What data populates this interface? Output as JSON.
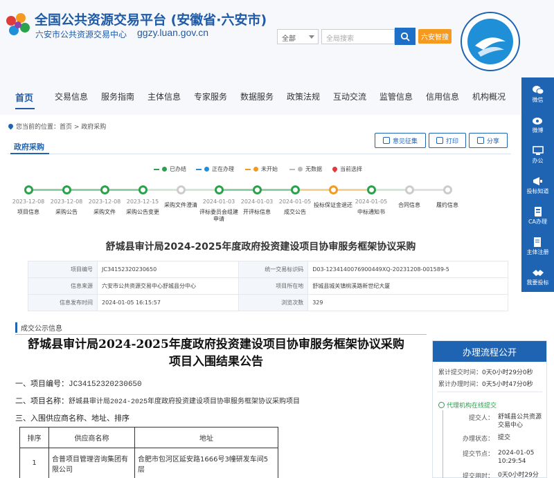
{
  "header": {
    "title": "全国公共资源交易平台 (安徽省·六安市)",
    "subtitle": "六安市公共资源交易中心",
    "domain": "ggzy.luan.gov.cn",
    "search_select": "全部",
    "search_placeholder": "全局搜索",
    "tag": "六安智搜"
  },
  "nav": [
    "首页",
    "交易信息",
    "服务指南",
    "主体信息",
    "专家服务",
    "数据服务",
    "政策法规",
    "互动交流",
    "监管信息",
    "信用信息",
    "机构概况"
  ],
  "side": [
    "微信",
    "微博",
    "办公",
    "投标知道",
    "CA办理",
    "主体注册",
    "我要投标"
  ],
  "crumb": "您当前的位置：首页 > 政府采购",
  "section_tab": "政府采购",
  "actions": [
    "意见征集",
    "打印",
    "分享"
  ],
  "legend": [
    {
      "label": "已办结",
      "color": "#2aa14a"
    },
    {
      "label": "正在办理",
      "color": "#1f8fd8"
    },
    {
      "label": "未开始",
      "color": "#f39a1f"
    },
    {
      "label": "无数据",
      "color": "#bbbbbb"
    },
    {
      "label": "当前选择",
      "color": "#e03b3b"
    }
  ],
  "timeline": [
    {
      "date": "2023-12-08",
      "name": "项目信息",
      "state": "done"
    },
    {
      "date": "2023-12-08",
      "name": "采购公告",
      "state": "done"
    },
    {
      "date": "2023-12-08",
      "name": "采购文件",
      "state": "done"
    },
    {
      "date": "2023-12-15",
      "name": "采购公告变更",
      "state": "done"
    },
    {
      "date": "",
      "name": "采购文件澄清",
      "state": "none"
    },
    {
      "date": "2024-01-03",
      "name": "评标委员会组建申请",
      "state": "done"
    },
    {
      "date": "2024-01-03",
      "name": "开评标信息",
      "state": "done"
    },
    {
      "date": "2024-01-05",
      "name": "成交公告",
      "state": "done"
    },
    {
      "date": "",
      "name": "投标保证金退还",
      "state": "pending"
    },
    {
      "date": "2024-01-05",
      "name": "中标通知书",
      "state": "done"
    },
    {
      "date": "",
      "name": "合同信息",
      "state": "none"
    },
    {
      "date": "",
      "name": "履约信息",
      "state": "none"
    }
  ],
  "project_title": "舒城县审计局2024-2025年度政府投资建设项目协审服务框架协议采购",
  "info": [
    [
      "项目编号",
      "JC34152320230650",
      "统一交易标识码",
      "D03-1234140076900449XQ-20231208-001589-5"
    ],
    [
      "信息来源",
      "六安市公共资源交易中心舒城县分中心",
      "项目所在地",
      "舒城县城关镇桃溪路新世纪大厦"
    ],
    [
      "信息发布时间",
      "2024-01-05 16:15:57",
      "浏览次数",
      "329"
    ]
  ],
  "notice": {
    "header": "成交公示信息",
    "title_line1": "舒城县审计局2024-2025年度政府投资建设项目协审服务框架协议采购",
    "title_line2": "项目入围结果公告",
    "p1_label": "一、项目编号：",
    "p1_value": "JC34152320230650",
    "p2_label": "二、项目名称：",
    "p2_value": "舒城县审计局2024-2025年度政府投资建设项目协审服务框架协议采购项目",
    "p3": "三、入围供应商名称、地址、排序",
    "table_headers": [
      "排序",
      "供应商名称",
      "地址"
    ],
    "table_rows": [
      [
        "1",
        "合普项目管理咨询集团有限公司",
        "合肥市包河区延安路1666号3幢研发车间5层"
      ]
    ]
  },
  "flow": {
    "title": "办理流程公开",
    "total_submit_label": "累计提交时间：",
    "total_submit_value": "0天0小时29分0秒",
    "total_handle_label": "累计办理时间：",
    "total_handle_value": "0天5小时47分0秒",
    "status": "代理机构在线提交",
    "submitter_label": "提交人：",
    "submitter_value": "舒城县公共资源交易中心",
    "state_label": "办理状态：",
    "state_value": "提交",
    "node_label": "提交节点：",
    "node_value": "2024-01-05 10:29:54",
    "used_label": "提交用时：",
    "used_value": "0天0小时29分"
  }
}
